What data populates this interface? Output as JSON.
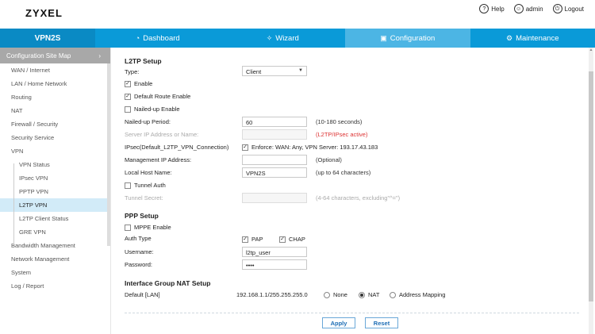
{
  "header": {
    "logo": "ZYXEL",
    "links": [
      {
        "label": "Help",
        "icon": "help-icon"
      },
      {
        "label": "admin",
        "icon": "user-icon"
      },
      {
        "label": "Logout",
        "icon": "logout-icon"
      }
    ]
  },
  "nav": {
    "model": "VPN2S",
    "tabs": [
      {
        "label": "Dashboard",
        "icon": "gauge-icon"
      },
      {
        "label": "Wizard",
        "icon": "wand-icon"
      },
      {
        "label": "Configuration",
        "icon": "config-icon",
        "active": true
      },
      {
        "label": "Maintenance",
        "icon": "gear-icon"
      }
    ],
    "color": "#0a9ad8"
  },
  "sidebar": {
    "title": "Configuration Site Map",
    "items": [
      {
        "label": "WAN / Internet"
      },
      {
        "label": "LAN / Home Network"
      },
      {
        "label": "Routing"
      },
      {
        "label": "NAT"
      },
      {
        "label": "Firewall / Security"
      },
      {
        "label": "Security Service"
      },
      {
        "label": "VPN"
      },
      {
        "label": "VPN Status"
      },
      {
        "label": "IPsec VPN"
      },
      {
        "label": "PPTP VPN"
      },
      {
        "label": "L2TP VPN",
        "active": true
      },
      {
        "label": "L2TP Client Status"
      },
      {
        "label": "GRE VPN"
      },
      {
        "label": "Bandwidth Management"
      },
      {
        "label": "Network Management"
      },
      {
        "label": "System"
      },
      {
        "label": "Log / Report"
      }
    ]
  },
  "l2tp": {
    "title": "L2TP Setup",
    "type_label": "Type:",
    "type_value": "Client",
    "enable": "Enable",
    "default_route": "Default Route Enable",
    "nailed_enable": "Nailed-up Enable",
    "nailed_period_label": "Nailed-up Period:",
    "nailed_period_value": "60",
    "nailed_period_hint": "(10-180 seconds)",
    "server_ip_label": "Server IP Address or Name:",
    "server_ip_hint": "(L2TP/IPsec active)",
    "ipsec_label": "IPsec(Default_L2TP_VPN_Connection)",
    "ipsec_enforce": "Enforce: WAN: Any, VPN Server: 193.17.43.183",
    "mgmt_ip_label": "Management IP Address:",
    "mgmt_ip_hint": "(Optional)",
    "local_host_label": "Local Host Name:",
    "local_host_value": "VPN2S",
    "local_host_hint": "(up to 64 characters)",
    "tunnel_auth": "Tunnel Auth",
    "tunnel_secret_label": "Tunnel Secret:",
    "tunnel_secret_hint": "(4-64 characters, excluding\"^=\")"
  },
  "ppp": {
    "title": "PPP Setup",
    "mppe": "MPPE Enable",
    "auth_label": "Auth Type",
    "pap": "PAP",
    "chap": "CHAP",
    "username_label": "Username:",
    "username_value": "l2tp_user",
    "password_label": "Password:",
    "password_value": "••••"
  },
  "nat": {
    "title": "Interface Group NAT Setup",
    "row_label": "Default [LAN]",
    "subnet": "192.168.1.1/255.255.255.0",
    "opt_none": "None",
    "opt_nat": "NAT",
    "opt_addr": "Address Mapping"
  },
  "buttons": {
    "apply": "Apply",
    "reset": "Reset"
  }
}
